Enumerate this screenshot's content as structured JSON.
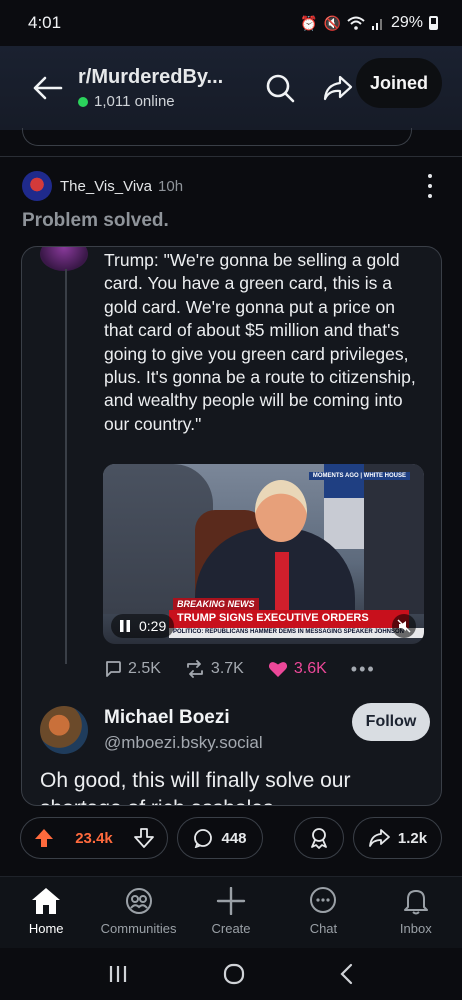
{
  "status_bar": {
    "time": "4:01",
    "battery": "29%"
  },
  "header": {
    "subreddit": "r/MurderedBy...",
    "online": "1,011 online",
    "joined_label": "Joined"
  },
  "post": {
    "username": "The_Vis_Viva",
    "age": "10h",
    "title": "Problem solved."
  },
  "embed": {
    "quote": "Trump: \"We're gonna be selling a gold card. You have a green card, this is a gold card. We're gonna put a price on that card of about $5 million and that's going to give you green card privileges, plus. It's gonna be a route to citizenship, and wealthy people will be coming into our country.\"",
    "video": {
      "time": "0:29",
      "top_tag": "MOMENTS AGO | WHITE HOUSE",
      "breaking": "BREAKING NEWS",
      "headline": "TRUMP SIGNS EXECUTIVE ORDERS",
      "ticker": "POLITICO: REPUBLICANS HAMMER DEMS IN MESSAGING     SPEAKER JOHNSON"
    },
    "stats": {
      "replies": "2.5K",
      "reposts": "3.7K",
      "likes": "3.6K"
    },
    "author": {
      "name": "Michael Boezi",
      "handle": "@mboezi.bsky.social",
      "follow_label": "Follow"
    },
    "reply_text": "Oh good, this will finally solve our shortage of rich assholes."
  },
  "actions": {
    "votes": "23.4k",
    "comments": "448",
    "shares": "1.2k"
  },
  "bottom_nav": [
    {
      "label": "Home",
      "icon": "home-icon"
    },
    {
      "label": "Communities",
      "icon": "communities-icon"
    },
    {
      "label": "Create",
      "icon": "plus-icon"
    },
    {
      "label": "Chat",
      "icon": "chat-icon"
    },
    {
      "label": "Inbox",
      "icon": "bell-icon"
    }
  ],
  "colors": {
    "accent_upvote": "#ff6a3d",
    "like_pink": "#ec4899",
    "online_green": "#2bd35c"
  }
}
